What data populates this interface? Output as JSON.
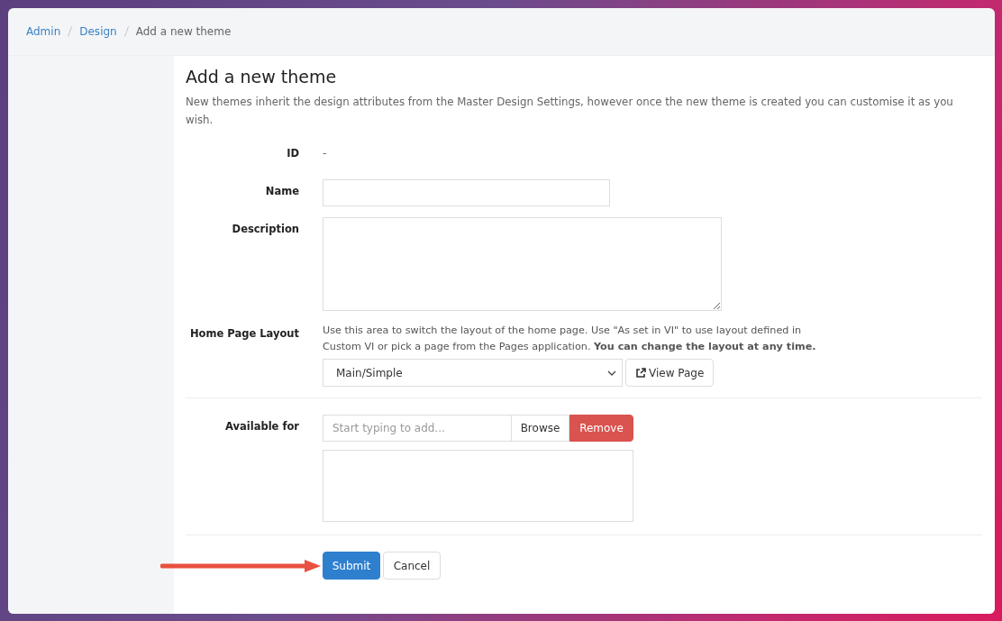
{
  "breadcrumb": [
    {
      "label": "Admin",
      "current": false
    },
    {
      "label": "Design",
      "current": false
    },
    {
      "label": "Add a new theme",
      "current": true
    }
  ],
  "page": {
    "title": "Add a new theme",
    "intro": "New themes inherit the design attributes from the Master Design Settings, however once the new theme is created you can customise it as you wish."
  },
  "form": {
    "id": {
      "label": "ID",
      "value": "-"
    },
    "name": {
      "label": "Name"
    },
    "description": {
      "label": "Description"
    },
    "home_page_layout": {
      "label": "Home Page Layout",
      "help": "Use this area to switch the layout of the home page. Use \"As set in VI\" to use layout defined in Custom VI or pick a page from the Pages application. **You can change the layout at any time.**",
      "value": "Main/Simple",
      "view_button": "View Page"
    },
    "available_for": {
      "label": "Available for",
      "placeholder": "Start typing to add...",
      "browse_button": "Browse",
      "remove_button": "Remove"
    },
    "actions": {
      "submit": "Submit",
      "cancel": "Cancel"
    }
  }
}
